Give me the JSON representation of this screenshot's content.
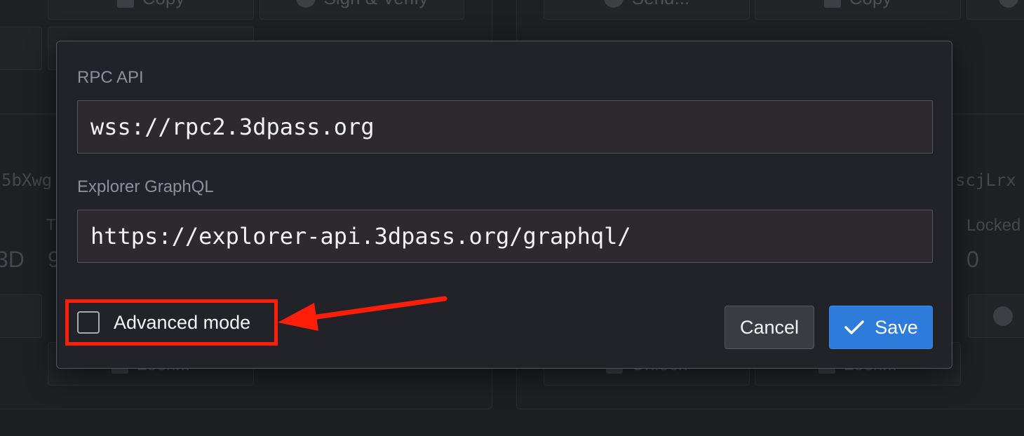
{
  "background": {
    "buttons_left": {
      "copy": "Copy",
      "sign_verify": "Sign & Verify",
      "lock": "Lock..."
    },
    "buttons_right": {
      "send": "Send...",
      "copy": "Copy",
      "unlock": "Unlock",
      "lock": "Lock..."
    },
    "address_left_fragment": "5bXwg",
    "address_right_fragment": "scjLrx",
    "balance_left_fragment": "3D",
    "balance_left_value_fragment": "9",
    "left_label_fragment": "T",
    "locked_label": "Locked",
    "locked_value": "0"
  },
  "modal": {
    "rpc_label": "RPC API",
    "rpc_value": "wss://rpc2.3dpass.org",
    "graphql_label": "Explorer GraphQL",
    "graphql_value": "https://explorer-api.3dpass.org/graphql/",
    "advanced_mode_label": "Advanced mode",
    "advanced_mode_checked": false,
    "cancel_label": "Cancel",
    "save_label": "Save"
  },
  "colors": {
    "modal_bg": "#222328",
    "input_bg": "#2c2a2f",
    "save_bg": "#2d7cdc",
    "cancel_bg": "#3a3c42",
    "highlight_red": "#ff1e0a"
  }
}
